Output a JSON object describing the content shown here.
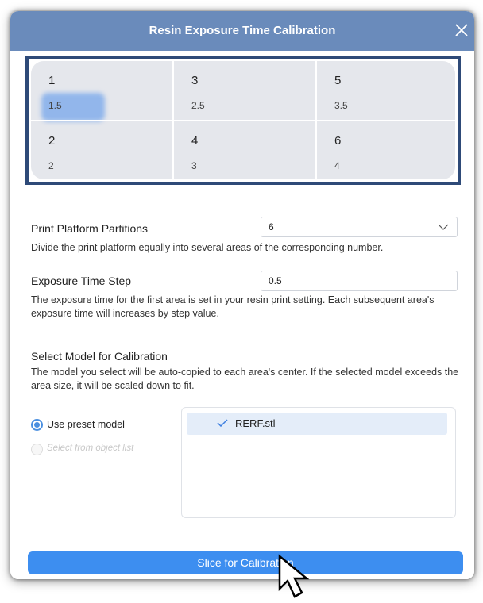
{
  "dialog": {
    "title": "Resin Exposure Time Calibration"
  },
  "grid": {
    "cells": [
      {
        "number": "1",
        "value": "1.5"
      },
      {
        "number": "3",
        "value": "2.5"
      },
      {
        "number": "5",
        "value": "3.5"
      },
      {
        "number": "2",
        "value": "2"
      },
      {
        "number": "4",
        "value": "3"
      },
      {
        "number": "6",
        "value": "4"
      }
    ]
  },
  "partitions": {
    "label": "Print Platform Partitions",
    "value": "6",
    "description": "Divide the print platform equally into several areas of the corresponding number."
  },
  "exposure_step": {
    "label": "Exposure Time Step",
    "value": "0.5",
    "description": "The exposure time for the first area is set in your resin print setting. Each subsequent area's exposure time will increases by step value."
  },
  "model_select": {
    "label": "Select Model for Calibration",
    "description": "The model you select will be auto-copied to each area's center. If the selected model exceeds the area size, it will be scaled down to fit.",
    "options": [
      {
        "label": "Use preset model",
        "selected": true,
        "enabled": true
      },
      {
        "label": "Select from object list",
        "selected": false,
        "enabled": false
      }
    ],
    "models": [
      {
        "name": "RERF.stl",
        "checked": true
      }
    ]
  },
  "actions": {
    "slice_label": "Slice for Calibration"
  },
  "colors": {
    "titlebar": "#6a8bbb",
    "accent": "#3d8ef0",
    "grid_frame": "#2e4a78",
    "grid_bg": "#e5e7ec"
  }
}
